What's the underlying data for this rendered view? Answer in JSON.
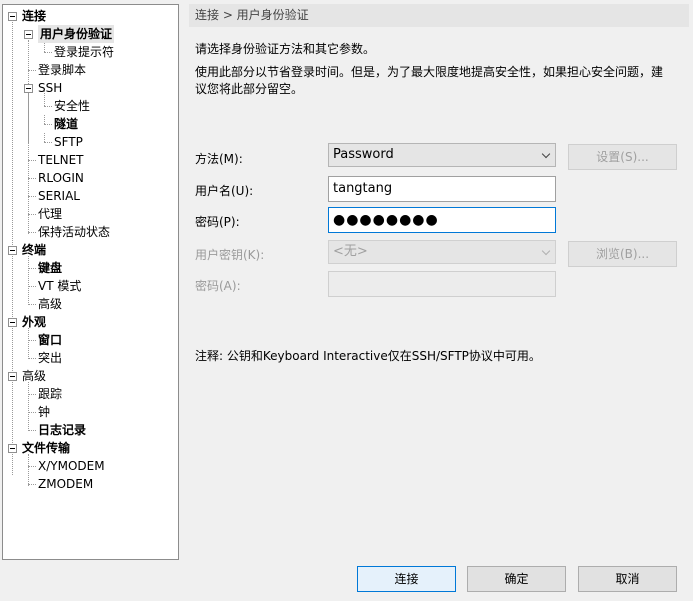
{
  "tree": {
    "items": [
      {
        "label": "连接"
      },
      {
        "label": "用户身份验证"
      },
      {
        "label": "登录提示符"
      },
      {
        "label": "登录脚本"
      },
      {
        "label": "SSH"
      },
      {
        "label": "安全性"
      },
      {
        "label": "隧道"
      },
      {
        "label": "SFTP"
      },
      {
        "label": "TELNET"
      },
      {
        "label": "RLOGIN"
      },
      {
        "label": "SERIAL"
      },
      {
        "label": "代理"
      },
      {
        "label": "保持活动状态"
      },
      {
        "label": "终端"
      },
      {
        "label": "键盘"
      },
      {
        "label": "VT 模式"
      },
      {
        "label": "高级"
      },
      {
        "label": "外观"
      },
      {
        "label": "窗口"
      },
      {
        "label": "突出"
      },
      {
        "label": "高级"
      },
      {
        "label": "跟踪"
      },
      {
        "label": "钟"
      },
      {
        "label": "日志记录"
      },
      {
        "label": "文件传输"
      },
      {
        "label": "X/YMODEM"
      },
      {
        "label": "ZMODEM"
      }
    ]
  },
  "breadcrumb": "连接 > 用户身份验证",
  "desc_line1": "请选择身份验证方法和其它参数。",
  "desc_line2": "使用此部分以节省登录时间。但是，为了最大限度地提高安全性，如果担心安全问题，建",
  "desc_line3": "议您将此部分留空。",
  "form": {
    "method_label": "方法(M):",
    "method_value": "Password",
    "settings_button": "设置(S)...",
    "username_label": "用户名(U):",
    "username_value": "tangtang",
    "password_label": "密码(P):",
    "password_value": "●●●●●●●●",
    "userkey_label": "用户密钥(K):",
    "userkey_value": "<无>",
    "browse_button": "浏览(B)...",
    "passphrase_label": "密码(A):"
  },
  "note": "注释: 公钥和Keyboard Interactive仅在SSH/SFTP协议中可用。",
  "buttons": {
    "connect": "连接",
    "ok": "确定",
    "cancel": "取消"
  }
}
